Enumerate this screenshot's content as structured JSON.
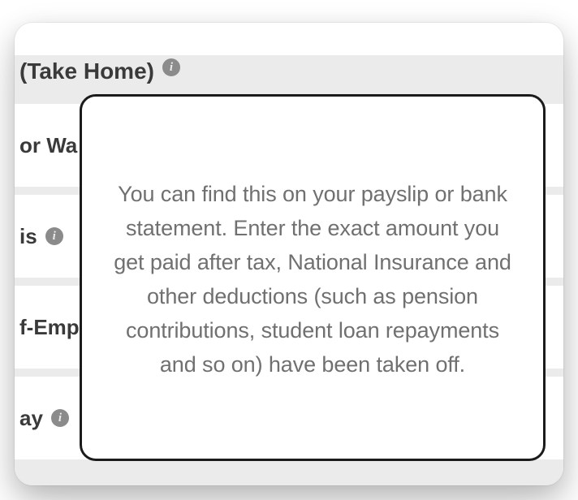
{
  "rows": {
    "r0": {
      "label": "(Take Home)"
    },
    "r1": {
      "label": "or Wa"
    },
    "r2": {
      "label": "is"
    },
    "r3": {
      "label": "f-Emp"
    },
    "r4": {
      "label": "ay"
    }
  },
  "icons": {
    "info_glyph": "i"
  },
  "tooltip": {
    "text": "You can find this on your payslip or bank statement. Enter the exact amount you get paid after tax, National Insurance and other deductions (such as pension contributions, student loan repayments and so on) have been taken off."
  }
}
